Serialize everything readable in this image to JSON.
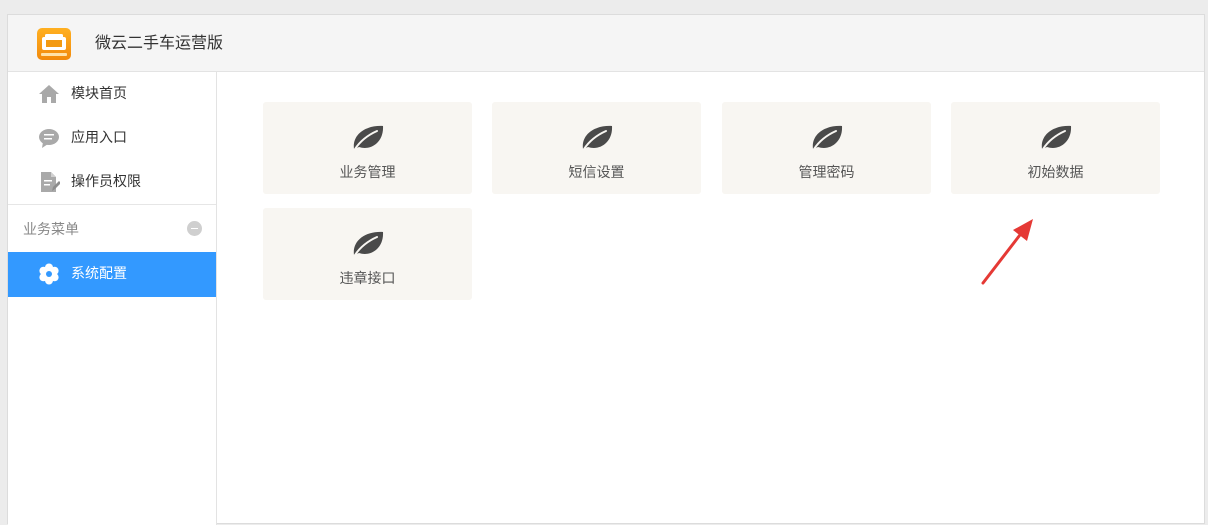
{
  "header": {
    "app_title": "微云二手车运营版",
    "logo_icon": "car-logo-icon"
  },
  "sidebar": {
    "items": [
      {
        "label": "模块首页",
        "icon": "home-icon"
      },
      {
        "label": "应用入口",
        "icon": "chat-bubble-icon"
      },
      {
        "label": "操作员权限",
        "icon": "document-edit-icon"
      }
    ],
    "section": {
      "label": "业务菜单",
      "collapse_icon": "minus-circle-icon"
    },
    "active_item": {
      "label": "系统配置",
      "icon": "gear-icon"
    }
  },
  "tiles": [
    {
      "label": "业务管理",
      "icon": "leaf-icon"
    },
    {
      "label": "短信设置",
      "icon": "leaf-icon"
    },
    {
      "label": "管理密码",
      "icon": "leaf-icon"
    },
    {
      "label": "初始数据",
      "icon": "leaf-icon"
    },
    {
      "label": "违章接口",
      "icon": "leaf-icon"
    }
  ],
  "colors": {
    "accent": "#3399ff",
    "logo": "#f7a11a",
    "tile_bg": "#f8f6f2",
    "icon": "#4a4a4a",
    "annotation_arrow": "#e53935"
  }
}
